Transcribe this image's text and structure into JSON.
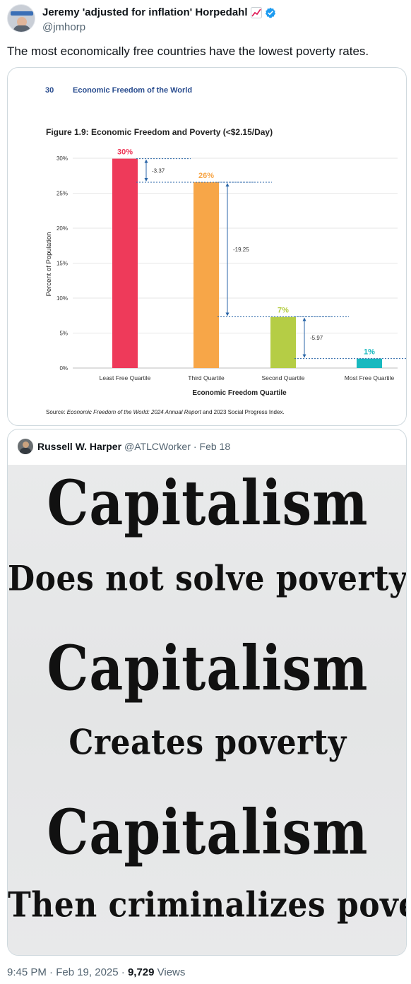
{
  "tweet": {
    "display_name": "Jeremy 'adjusted for inflation' Horpedahl",
    "handle": "@jmhorp",
    "text": "The most economically free countries have the lowest poverty rates.",
    "timestamp": "9:45 PM · Feb 19, 2025 · ",
    "views_count": "9,729",
    "views_label": " Views"
  },
  "chart_page": {
    "page_number": "30",
    "running_header": "Economic Freedom of the World",
    "source_prefix": "Source: ",
    "source_italic": "Economic Freedom of the World: 2024 Annual Report",
    "source_suffix": " and 2023 Social Progress Index."
  },
  "chart_data": {
    "type": "bar",
    "title": "Figure 1.9: Economic Freedom and Poverty (<$2.15/Day)",
    "xlabel": "Economic Freedom Quartile",
    "ylabel": "Percent of Population",
    "ylim": [
      0,
      30
    ],
    "yticks": [
      "0%",
      "5%",
      "10%",
      "15%",
      "20%",
      "25%",
      "30%"
    ],
    "categories": [
      "Least Free Quartile",
      "Third Quartile",
      "Second Quartile",
      "Most Free Quartile"
    ],
    "values": [
      29.94,
      26.57,
      7.32,
      1.35
    ],
    "value_labels": [
      "30%",
      "26%",
      "7%",
      "1%"
    ],
    "colors": [
      "#ee3a5a",
      "#f7a648",
      "#b5cd45",
      "#19b9bf"
    ],
    "differences": [
      "-3.37",
      "-19.25",
      "-5.97"
    ],
    "grid": true
  },
  "quoted_tweet": {
    "name": "Russell W. Harper",
    "handle": "@ATLCWorker",
    "separator": "·",
    "date": "Feb 18",
    "image_lines": [
      "Capitalism",
      "Does not solve poverty",
      "Capitalism",
      "Creates poverty",
      "Capitalism",
      "Then criminalizes poverty"
    ]
  },
  "icons": {
    "chart_emoji": "chart-increasing-icon",
    "verified": "verified-badge-icon"
  }
}
